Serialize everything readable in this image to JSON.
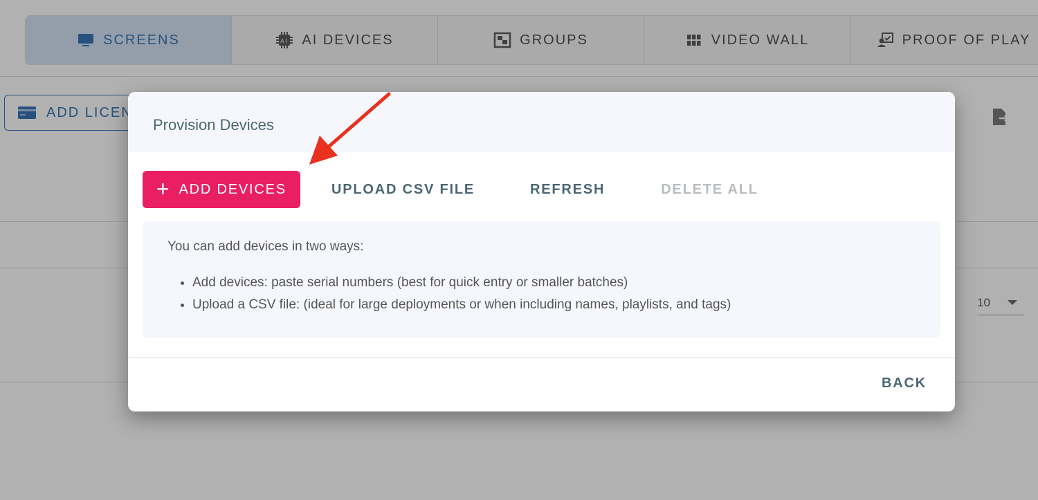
{
  "tabs": [
    {
      "label": "SCREENS",
      "icon": "monitor-icon",
      "active": true
    },
    {
      "label": "AI DEVICES",
      "icon": "ai-chip-icon",
      "active": false
    },
    {
      "label": "GROUPS",
      "icon": "groups-icon",
      "active": false
    },
    {
      "label": "VIDEO WALL",
      "icon": "grid-icon",
      "active": false
    },
    {
      "label": "PROOF OF PLAY",
      "icon": "proof-of-play-icon",
      "active": false
    }
  ],
  "toolbar": {
    "add_license_label": "ADD LICEN",
    "export_icon": "export-icon"
  },
  "pagination": {
    "rows_per_page": "10"
  },
  "modal": {
    "title": "Provision Devices",
    "add_devices_label": "ADD DEVICES",
    "upload_csv_label": "UPLOAD CSV FILE",
    "refresh_label": "REFRESH",
    "delete_all_label": "DELETE ALL",
    "info_intro": "You can add devices in two ways:",
    "info_items": [
      "Add devices: paste serial numbers (best for quick entry or smaller batches)",
      "Upload a CSV file: (ideal for large deployments or when including names, playlists, and tags)"
    ],
    "back_label": "BACK"
  },
  "colors": {
    "primary": "#ea1e62",
    "accent_blue": "#1b5fa8",
    "text_muted": "#4b6674",
    "annotation_arrow": "#e8311f"
  }
}
